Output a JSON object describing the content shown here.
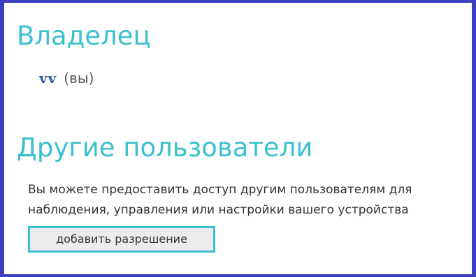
{
  "owner_section": {
    "heading": "Владелец",
    "owner_name": "vv",
    "owner_suffix": "(вы)"
  },
  "others_section": {
    "heading": "Другие пользователи",
    "description": "Вы можете предоставить доступ другим пользователям для наблюдения, управления или настройки вашего устройства",
    "add_button_label": "добавить разрешение"
  },
  "colors": {
    "accent": "#3cc0cf",
    "frame": "#3e3fbf",
    "owner_name": "#2b63a6"
  }
}
